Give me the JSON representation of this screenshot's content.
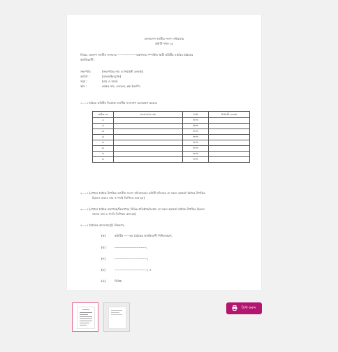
{
  "document": {
    "heading1": "বাংলাদেশ জাতীয় সংসদ সচিবালয়",
    "heading2": "কমিটি শাখা-১৬",
    "subject": "বিষয়ঃ  একাদশ জাতীয় সংসদের ------------------মন্ত্রণালয় সম্পর্কিত স্থায়ী কমিটির ৪র্থ/৫ম বৈঠকের",
    "subject_cont": "কার্যবিবরণী।",
    "chair_label": "সভাপতি:",
    "chair_value": "(সভাপতির নাম ও নির্বাচনী এলাকা)",
    "date_label": "তারিখ  :",
    "date_value": "(বাংলা/ইংরেজি)",
    "time_label": "সময়   :",
    "time_value": "(বার ও সময়)",
    "venue_label": "স্থান   :",
    "venue_value": "কক্ষের নাম, লেভেল, ব্লক ইত্যাদি।",
    "para1": "১.০০।  বৈঠকে কমিটির নিম্নোক্ত মাননীয় সদস্যগণ অংশগ্রহণ করেনঃ",
    "table": {
      "headers": [
        "ক্রমিক নং",
        "সদস্যগণের নাম",
        "পদবি",
        "নির্বাচনী এলাকা"
      ],
      "rows": [
        [
          "১।",
          "",
          "সদস্য",
          ""
        ],
        [
          "২।",
          "",
          "সদস্য",
          ""
        ],
        [
          "৩।",
          "",
          "সদস্য",
          ""
        ],
        [
          "৪।",
          "",
          "সদস্য",
          ""
        ],
        [
          "৫।",
          "",
          "সদস্য",
          ""
        ],
        [
          "৬।",
          "",
          "সদস্য",
          ""
        ],
        [
          "৭।",
          "",
          "সদস্য",
          ""
        ],
        [
          "৮।",
          "",
          "সদস্য",
          ""
        ]
      ]
    },
    "para2_l1": "২.০০।  (এখানে বৈঠকে উপস্থিত জাতীয় সংসদ সচিবালয়ের কমিটি সচিবসহ যে সকল কর্মকর্তা বৈঠকে উপস্থিত",
    "para2_l2": "ছিলেন তাদের নাম ও পদবি লিপিবদ্ধ করা হয়)",
    "para3_l1": "৩.০০।  (এখানে বৈঠকে মন্ত্রণালয়/বিভাগসহ বিভিন্ন প্রতিষ্ঠান/সংস্থার যে সকল কর্মকর্তা বৈঠকে উপস্থিত ছিলেন",
    "para3_l2": "তাদের নাম ও পদবি লিপিবদ্ধ করা হয়)",
    "para4": "৪.০০।  বৈঠকের আলোচ্যসূচি নিম্নরূপঃ",
    "items": [
      {
        "label": "(ক)",
        "text": "কমিটির  -----তম বৈঠকের কার্যবিবরণী নিশ্চিতকরণ;"
      },
      {
        "label": "(খ)",
        "text": "------------------------------;"
      },
      {
        "label": "(গ)",
        "text": "-------------------------------;"
      },
      {
        "label": "(ঘ)",
        "text": "-------------------------------; ও"
      },
      {
        "label": "(ঙ)",
        "text": "বিবিধ।"
      }
    ]
  },
  "print_button": {
    "label": "প্রিন্ট করুন",
    "icon": "printer-icon"
  },
  "thumbnails": [
    {
      "name": "page-1",
      "active": true
    },
    {
      "name": "page-2",
      "active": false
    }
  ],
  "colors": {
    "accent": "#b3166f",
    "thumb_active_border": "#e6658f",
    "background": "#f1f1f1"
  }
}
